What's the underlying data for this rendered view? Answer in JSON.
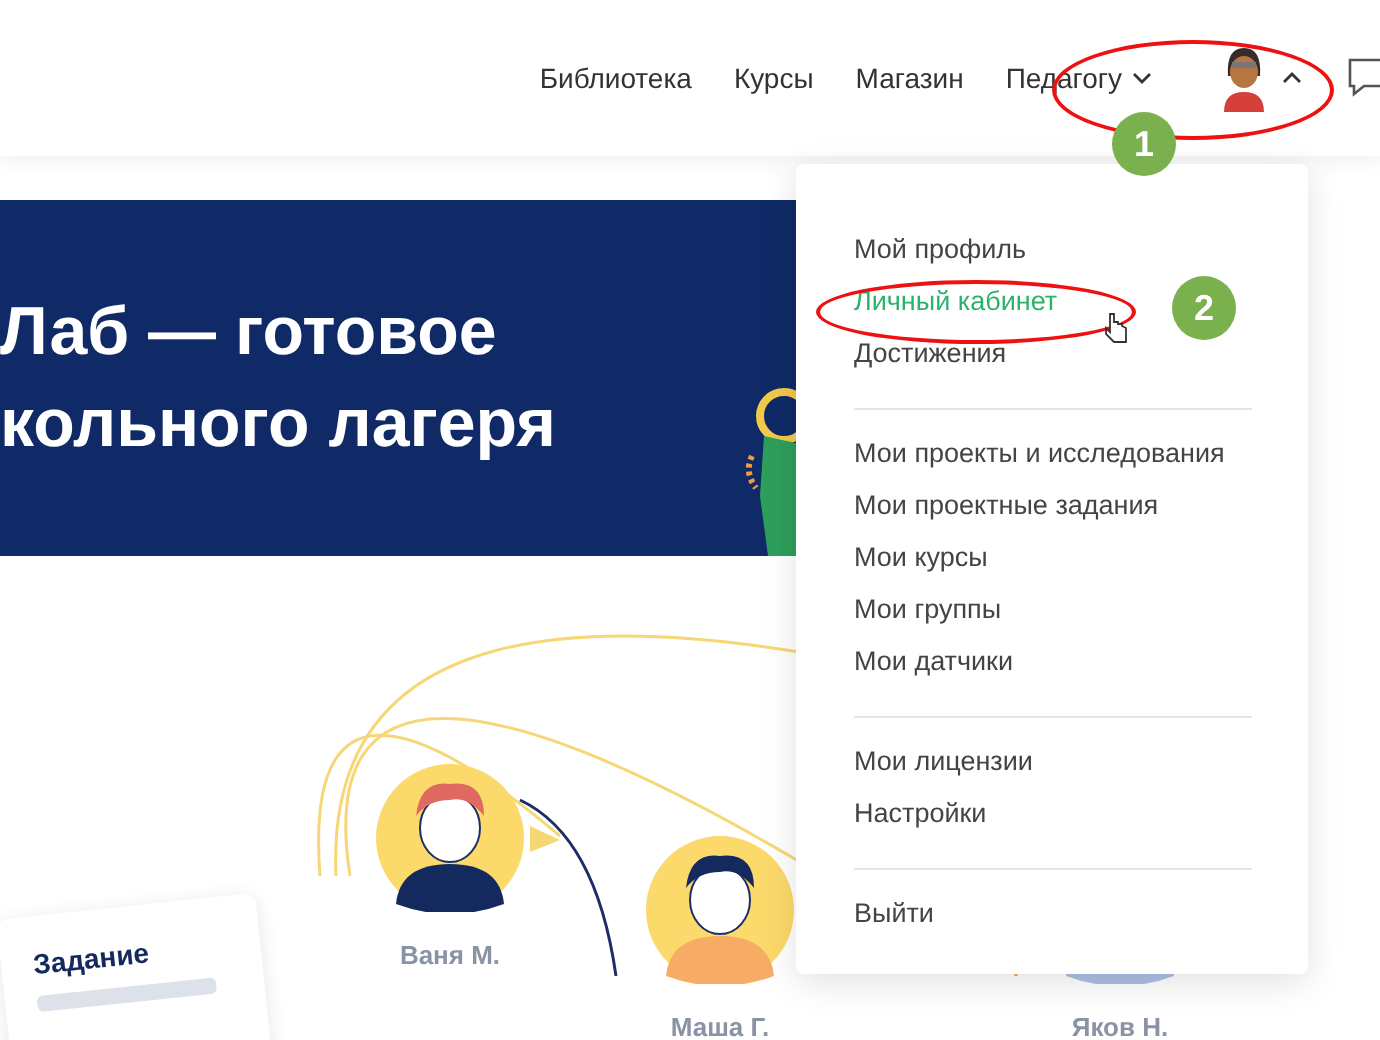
{
  "nav": {
    "items": [
      {
        "label": "Библиотека",
        "dropdown": false
      },
      {
        "label": "Курсы",
        "dropdown": false
      },
      {
        "label": "Магазин",
        "dropdown": false
      },
      {
        "label": "Педагогу",
        "dropdown": true
      }
    ],
    "user_menu": {
      "expanded": true
    }
  },
  "hero": {
    "lines": [
      "Лаб — готовое",
      "кольного лагеря"
    ]
  },
  "illustration": {
    "task_card": {
      "title": "Задание"
    },
    "students": [
      {
        "name": "Ваня М."
      },
      {
        "name": "Маша Г."
      },
      {
        "name": "Яков Н."
      }
    ]
  },
  "user_dropdown": {
    "groups": [
      [
        {
          "label": "Мой профиль",
          "selected": false
        },
        {
          "label": "Личный кабинет",
          "selected": true
        },
        {
          "label": "Достижения",
          "selected": false
        }
      ],
      [
        {
          "label": "Мои проекты и исследования",
          "selected": false
        },
        {
          "label": "Мои проектные задания",
          "selected": false
        },
        {
          "label": "Мои курсы",
          "selected": false
        },
        {
          "label": "Мои группы",
          "selected": false
        },
        {
          "label": "Мои датчики",
          "selected": false
        }
      ],
      [
        {
          "label": "Мои лицензии",
          "selected": false
        },
        {
          "label": "Настройки",
          "selected": false
        }
      ],
      [
        {
          "label": "Выйти",
          "selected": false
        }
      ]
    ]
  },
  "annotations": [
    {
      "number": "1"
    },
    {
      "number": "2"
    }
  ]
}
